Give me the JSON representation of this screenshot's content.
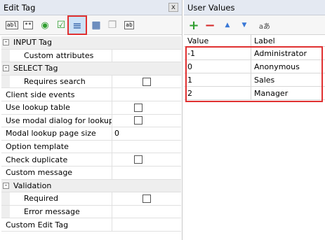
{
  "edit_tag": {
    "title": "Edit Tag",
    "close_glyph": "x",
    "toolbar": [
      {
        "name": "text-field-icon",
        "glyph": "abl"
      },
      {
        "name": "password-field-icon",
        "glyph": "**"
      },
      {
        "name": "radio-button-icon",
        "glyph": "◉"
      },
      {
        "name": "checkbox-icon",
        "glyph": "☑"
      },
      {
        "name": "select-tag-icon",
        "glyph": "≡",
        "selected": true
      },
      {
        "name": "table-icon",
        "glyph": "▦"
      },
      {
        "name": "clipboard-icon",
        "glyph": "❐"
      },
      {
        "name": "label-icon",
        "glyph": "ab"
      }
    ],
    "rows": [
      {
        "type": "category",
        "label": "INPUT Tag",
        "expander": "-"
      },
      {
        "type": "child",
        "label": "Custom attributes",
        "value": ""
      },
      {
        "type": "category",
        "label": "SELECT Tag",
        "expander": "-"
      },
      {
        "type": "child",
        "label": "Requires search",
        "checkbox": true
      },
      {
        "type": "top",
        "label": "Client side events",
        "value": ""
      },
      {
        "type": "top",
        "label": "Use lookup table",
        "checkbox": true
      },
      {
        "type": "top",
        "label": "Use modal dialog for lookup",
        "checkbox": true
      },
      {
        "type": "top",
        "label": "Modal lookup page size",
        "value": "0"
      },
      {
        "type": "top",
        "label": "Option template",
        "value": ""
      },
      {
        "type": "top",
        "label": "Check duplicate",
        "checkbox": true
      },
      {
        "type": "top",
        "label": "Custom message",
        "value": ""
      },
      {
        "type": "category",
        "label": "Validation",
        "expander": "-"
      },
      {
        "type": "child",
        "label": "Required",
        "checkbox": true
      },
      {
        "type": "child",
        "label": "Error message",
        "value": ""
      },
      {
        "type": "top",
        "label": "Custom Edit Tag",
        "value": ""
      }
    ]
  },
  "user_values": {
    "title": "User Values",
    "toolbar": [
      {
        "name": "add-icon",
        "glyph": "+",
        "color": "#2f9e2f"
      },
      {
        "name": "remove-icon",
        "glyph": "−",
        "color": "#d62b2b"
      },
      {
        "name": "move-up-icon",
        "glyph": "▲",
        "color": "#3a78d6"
      },
      {
        "name": "move-down-icon",
        "glyph": "▼",
        "color": "#3a78d6"
      },
      {
        "name": "translate-icon",
        "glyph": "aあ",
        "color": "#444444"
      }
    ],
    "columns": {
      "value": "Value",
      "label": "Label"
    },
    "rows": [
      {
        "value": "-1",
        "label": "Administrator"
      },
      {
        "value": "0",
        "label": "Anonymous"
      },
      {
        "value": "1",
        "label": "Sales"
      },
      {
        "value": "2",
        "label": "Manager"
      }
    ]
  },
  "colors": {
    "highlight": "#e03131",
    "header_bg": "#e4e9f2"
  }
}
